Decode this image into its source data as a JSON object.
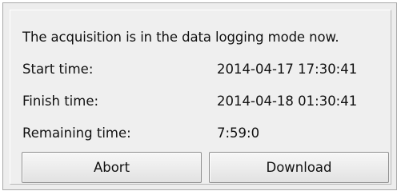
{
  "status": {
    "message": "The acquisition is in the data logging mode now."
  },
  "details": [
    {
      "label": "Start time:",
      "value": "2014-04-17 17:30:41"
    },
    {
      "label": "Finish time:",
      "value": "2014-04-18 01:30:41"
    },
    {
      "label": "Remaining time:",
      "value": "7:59:0"
    }
  ],
  "actions": {
    "abort_label": "Abort",
    "download_label": "Download"
  }
}
